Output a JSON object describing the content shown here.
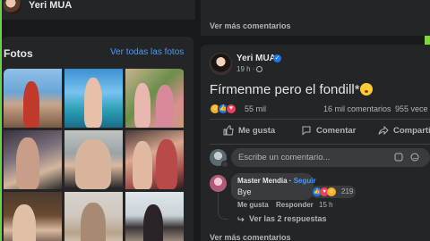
{
  "header": {
    "name": "Yeri MUA"
  },
  "photos": {
    "title": "Fotos",
    "see_all": "Ver todas las fotos",
    "items": [
      "photo-1",
      "photo-2",
      "photo-3",
      "photo-4",
      "photo-5",
      "photo-6",
      "photo-7",
      "photo-8",
      "photo-9"
    ]
  },
  "feed": {
    "top_more_comments": "Ver más comentarios",
    "bottom_more_comments": "Ver más comentarios"
  },
  "post": {
    "author": "Yeri MUA",
    "verified": true,
    "time": "19 h",
    "text": "Fírmenme pero el fondill*",
    "reaction_types": [
      "haha",
      "like",
      "love"
    ],
    "reaction_count": "55 mil",
    "comment_count": "16 mil comentarios",
    "view_count": "955 vece",
    "actions": {
      "like": "Me gusta",
      "comment": "Comentar",
      "share": "Comparti"
    },
    "comment_placeholder": "Escribe un comentario..."
  },
  "comment": {
    "author": "Master Mendia",
    "separator": " · ",
    "follow": "Seguir",
    "text": "Bye",
    "reaction_count": "219",
    "like_label": "Me gusta",
    "reply_label": "Responder",
    "time": "15 h",
    "view_replies": "Ver las 2 respuestas"
  },
  "colors": {
    "background": "#18191a",
    "card": "#242526",
    "input": "#3a3b3c",
    "link": "#4599ff",
    "text_primary": "#e4e6eb",
    "text_secondary": "#b0b3b8",
    "accent_edge": "#7dd83e"
  }
}
